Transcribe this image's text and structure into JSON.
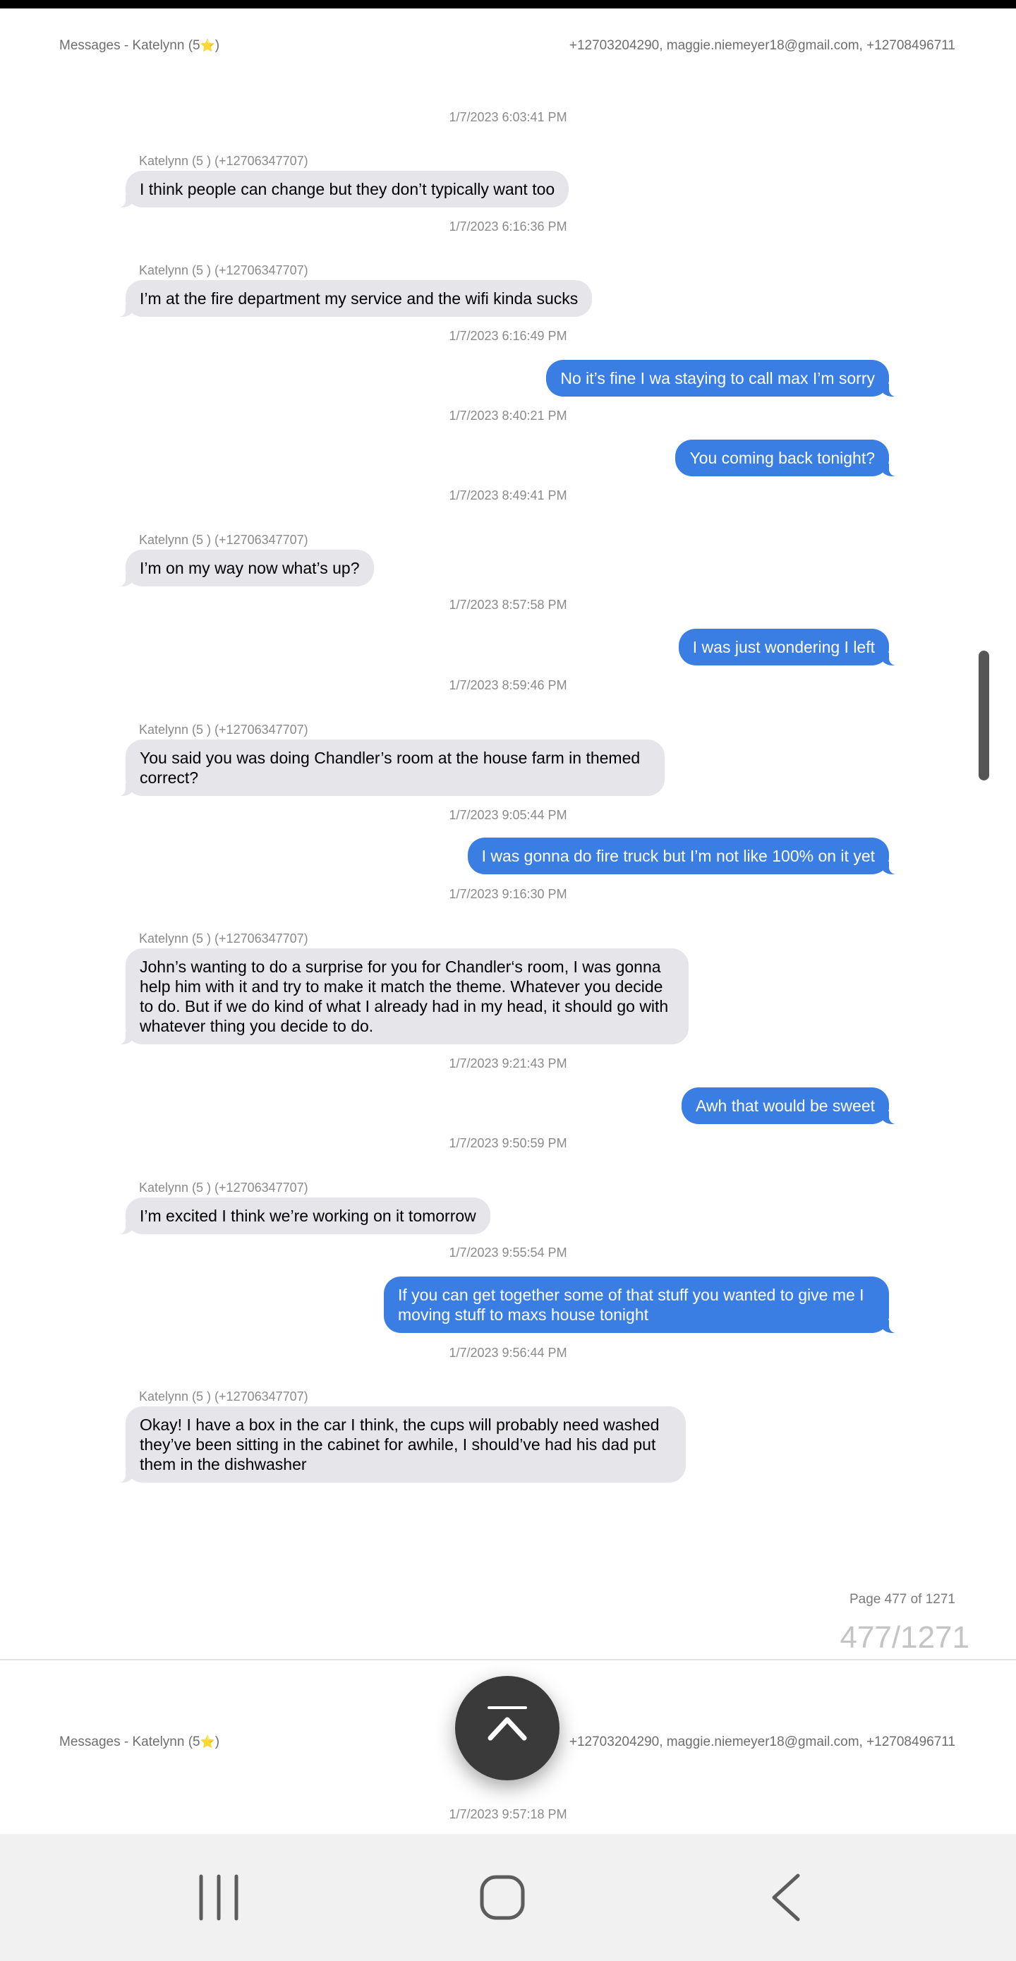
{
  "header": {
    "title": "Messages - Katelynn (5",
    "title_star": "⭐",
    "title_close": ")",
    "participants": "+12703204290, maggie.niemeyer18@gmail.com, +12708496711"
  },
  "messages": [
    {
      "time": "1/7/2023 6:03:41 PM",
      "direction": "in",
      "sender": "Katelynn (5 ) (+12706347707)",
      "text": "I think people can change but they don’t typically want too"
    },
    {
      "time": "1/7/2023 6:16:36 PM",
      "direction": "in",
      "sender": "Katelynn (5 ) (+12706347707)",
      "text": "I’m at the fire department my service and the wifi kinda sucks"
    },
    {
      "time": "1/7/2023 6:16:49 PM",
      "direction": "out",
      "text": "No it’s fine I wa staying to call max I’m sorry"
    },
    {
      "time": "1/7/2023 8:40:21 PM",
      "direction": "out",
      "text": "You coming back tonight?"
    },
    {
      "time": "1/7/2023 8:49:41 PM",
      "direction": "in",
      "sender": "Katelynn (5 ) (+12706347707)",
      "text": "I’m on my way now what’s up?"
    },
    {
      "time": "1/7/2023 8:57:58 PM",
      "direction": "out",
      "text": "I was just wondering I left"
    },
    {
      "time": "1/7/2023 8:59:46 PM",
      "direction": "in",
      "sender": "Katelynn (5 ) (+12706347707)",
      "text": "You said you was doing Chandler’s room at the house farm in themed correct?"
    },
    {
      "time": "1/7/2023 9:05:44 PM",
      "direction": "out",
      "text": "I was gonna do fire truck but I’m not like 100% on it yet"
    },
    {
      "time": "1/7/2023 9:16:30 PM",
      "direction": "in",
      "sender": "Katelynn (5 ) (+12706347707)",
      "text": "John’s wanting to do a surprise for you for Chandler‘s room, I was gonna help him with it and try to make it match the theme. Whatever you decide to do. But if we do kind of what I already had in my head, it should go with whatever thing you decide to do."
    },
    {
      "time": "1/7/2023 9:21:43 PM",
      "direction": "out",
      "text": "Awh that would be sweet"
    },
    {
      "time": "1/7/2023 9:50:59 PM",
      "direction": "in",
      "sender": "Katelynn (5 ) (+12706347707)",
      "text": "I’m excited I think we’re working on it tomorrow"
    },
    {
      "time": "1/7/2023 9:55:54 PM",
      "direction": "out",
      "text": "If you can get together some of that stuff you wanted to give me I moving stuff to maxs house tonight"
    },
    {
      "time": "1/7/2023 9:56:44 PM",
      "direction": "in",
      "sender": "Katelynn (5 ) (+12706347707)",
      "text": "Okay! I have a box in the car I think, the cups will probably need washed they’ve been sitting in the cabinet for awhile, I should’ve had his dad put them in the dishwasher"
    }
  ],
  "footer": {
    "page_text": "Page 477 of 1271",
    "page_counter": "477/1271"
  },
  "next_page": {
    "title": "Messages - Katelynn (5",
    "title_star": "⭐",
    "title_close": ")",
    "participants": "+12703204290, maggie.niemeyer18@gmail.com, +12708496711",
    "first_time": "1/7/2023 9:57:18 PM"
  },
  "icons": {
    "fab": "chevron-up-icon",
    "nav_recents": "recents-icon",
    "nav_home": "home-icon",
    "nav_back": "back-icon"
  },
  "colors": {
    "outgoing_bubble": "#3a7ee4",
    "incoming_bubble": "#e5e5ea"
  }
}
